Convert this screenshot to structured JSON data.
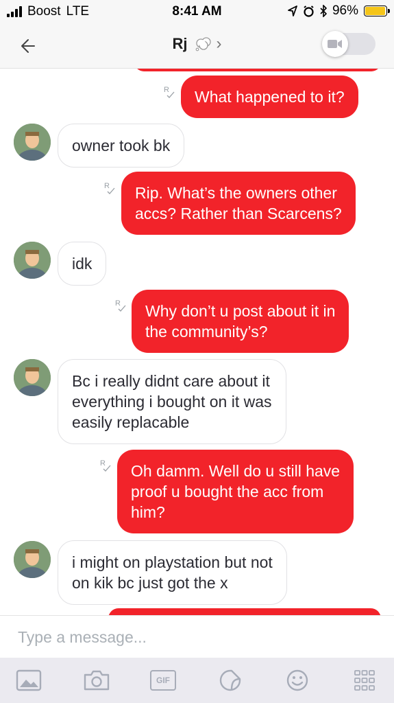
{
  "status_bar": {
    "carrier": "Boost",
    "network": "LTE",
    "time": "8:41 AM",
    "battery_percent": "96%",
    "battery_level": 0.96,
    "battery_color": "#f5c518"
  },
  "header": {
    "contact_name": "Rj",
    "contact_icon": "thought-bubble-icon",
    "back_icon": "back-arrow-icon",
    "video_icon": "video-camera-icon"
  },
  "messages": [
    {
      "side": "out",
      "lines": [
        "What happened to it?"
      ]
    },
    {
      "side": "in",
      "lines": [
        "owner took bk"
      ]
    },
    {
      "side": "out",
      "lines": [
        "Rip. What’s the owners other",
        "accs? Rather than Scarcens?"
      ]
    },
    {
      "side": "in",
      "lines": [
        "idk"
      ]
    },
    {
      "side": "out",
      "lines": [
        "Why don’t u post about it in",
        "the community’s?"
      ]
    },
    {
      "side": "in",
      "lines": [
        "Bc i really didnt care about it",
        "everything i bought on it was",
        "easily replacable"
      ]
    },
    {
      "side": "out",
      "lines": [
        "Oh damm. Well do u still have",
        "proof u bought the acc from",
        "him?"
      ]
    },
    {
      "side": "in",
      "lines": [
        "i might on playstation but not",
        "on kik bc just got the x"
      ]
    }
  ],
  "composer": {
    "placeholder": "Type a message..."
  },
  "toolbar": {
    "gif_label": "GIF",
    "icons": [
      "gallery-icon",
      "camera-icon",
      "gif-icon",
      "sticker-icon",
      "emoji-icon",
      "apps-grid-icon"
    ]
  },
  "colors": {
    "outgoing_bubble": "#f2232a",
    "incoming_border": "#e1e1e4",
    "toolbar_bg": "#ebeaf0"
  }
}
